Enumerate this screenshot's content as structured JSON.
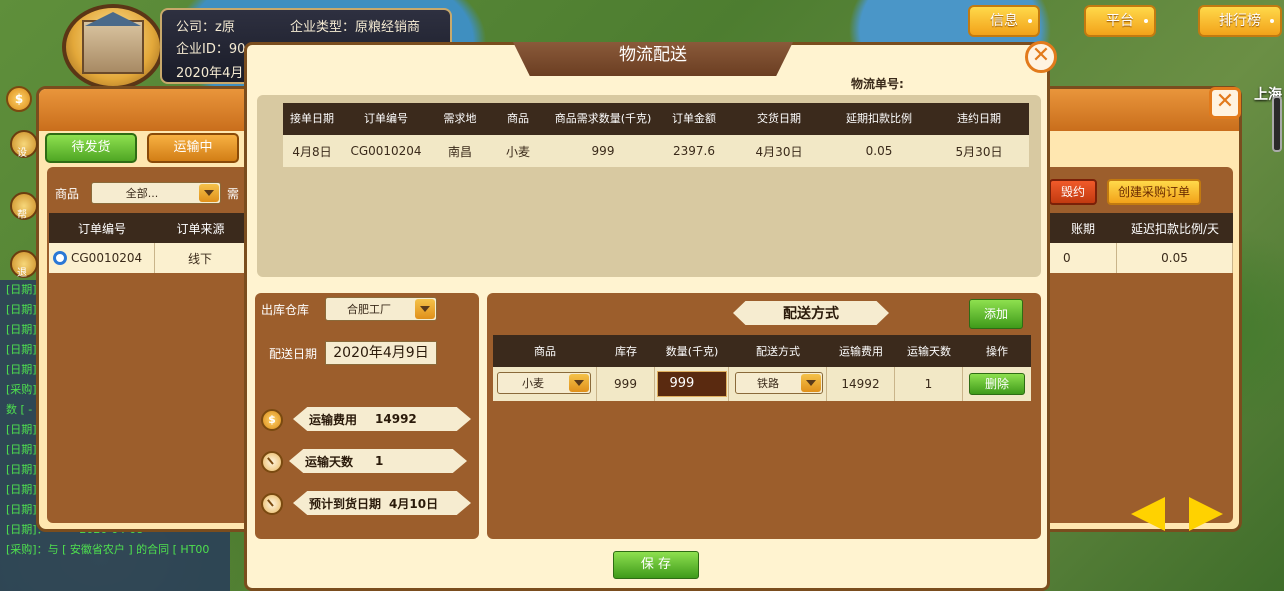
{
  "profile": {
    "company": "公司：z原",
    "company_type": "企业类型：原粮经销商",
    "company_id": "企业ID：90",
    "date": "2020年4月"
  },
  "top_buttons": [
    "信息",
    "平台",
    "排行榜"
  ],
  "city_label": "上海",
  "back_panel": {
    "tabs": [
      "待发货",
      "运输中"
    ],
    "filter_label": "商品",
    "filter_value": "全部...",
    "filter_label_cut": "需",
    "left_headers": [
      "订单编号",
      "订单来源"
    ],
    "left_row": [
      "CG0010204",
      "线下"
    ],
    "btn_contract": "毁约",
    "btn_create": "创建采购订单",
    "right_headers": [
      "账期",
      "延迟扣款比例/天"
    ],
    "right_row": [
      "0",
      "0.05"
    ],
    "side_labels": [
      "设",
      "帮",
      "退"
    ]
  },
  "log": [
    "[日期]",
    "[日期]",
    "[日期]",
    "[日期]",
    "[日期]",
    "[采购]",
    "数 [ -",
    "[日期]",
    "[日期]",
    "[日期]",
    "[日期]",
    "[日期]",
    "[日期]：--------2020-04-08--------",
    "[采购]：与 [ 安徽省农户 ] 的合同 [ HT00"
  ],
  "modal": {
    "title": "物流配送",
    "order_no_label": "物流单号:",
    "table": {
      "headers": [
        "接单日期",
        "订单编号",
        "需求地",
        "商品",
        "商品需求数量(千克)",
        "订单金额",
        "交货日期",
        "延期扣款比例",
        "违约日期"
      ],
      "row": [
        "4月8日",
        "CG0010204",
        "南昌",
        "小麦",
        "999",
        "2397.6",
        "4月30日",
        "0.05",
        "5月30日"
      ]
    },
    "warehouse_label": "出库仓库",
    "warehouse_value": "合肥工厂",
    "ship_date_label": "配送日期",
    "ship_date_value": "2020年4月9日",
    "cost_label": "运输费用",
    "cost_value": "14992",
    "days_label": "运输天数",
    "days_value": "1",
    "eta_label": "预计到货日期",
    "eta_value": "4月10日",
    "method_title": "配送方式",
    "add_btn": "添加",
    "detail_headers": [
      "商品",
      "库存",
      "数量(千克)",
      "配送方式",
      "运输费用",
      "运输天数",
      "操作"
    ],
    "detail_row": {
      "product": "小麦",
      "stock": "999",
      "qty": "999",
      "method": "铁路",
      "cost": "14992",
      "days": "1",
      "delete": "删除"
    },
    "save_btn": "保 存"
  },
  "colors": {
    "accent_orange": "#e27a1b",
    "panel_brown": "#9c5e2c",
    "header_dark": "#3b2a1c",
    "green_button": "#4fa624",
    "nav_arrow_yellow": "#ffd200"
  }
}
